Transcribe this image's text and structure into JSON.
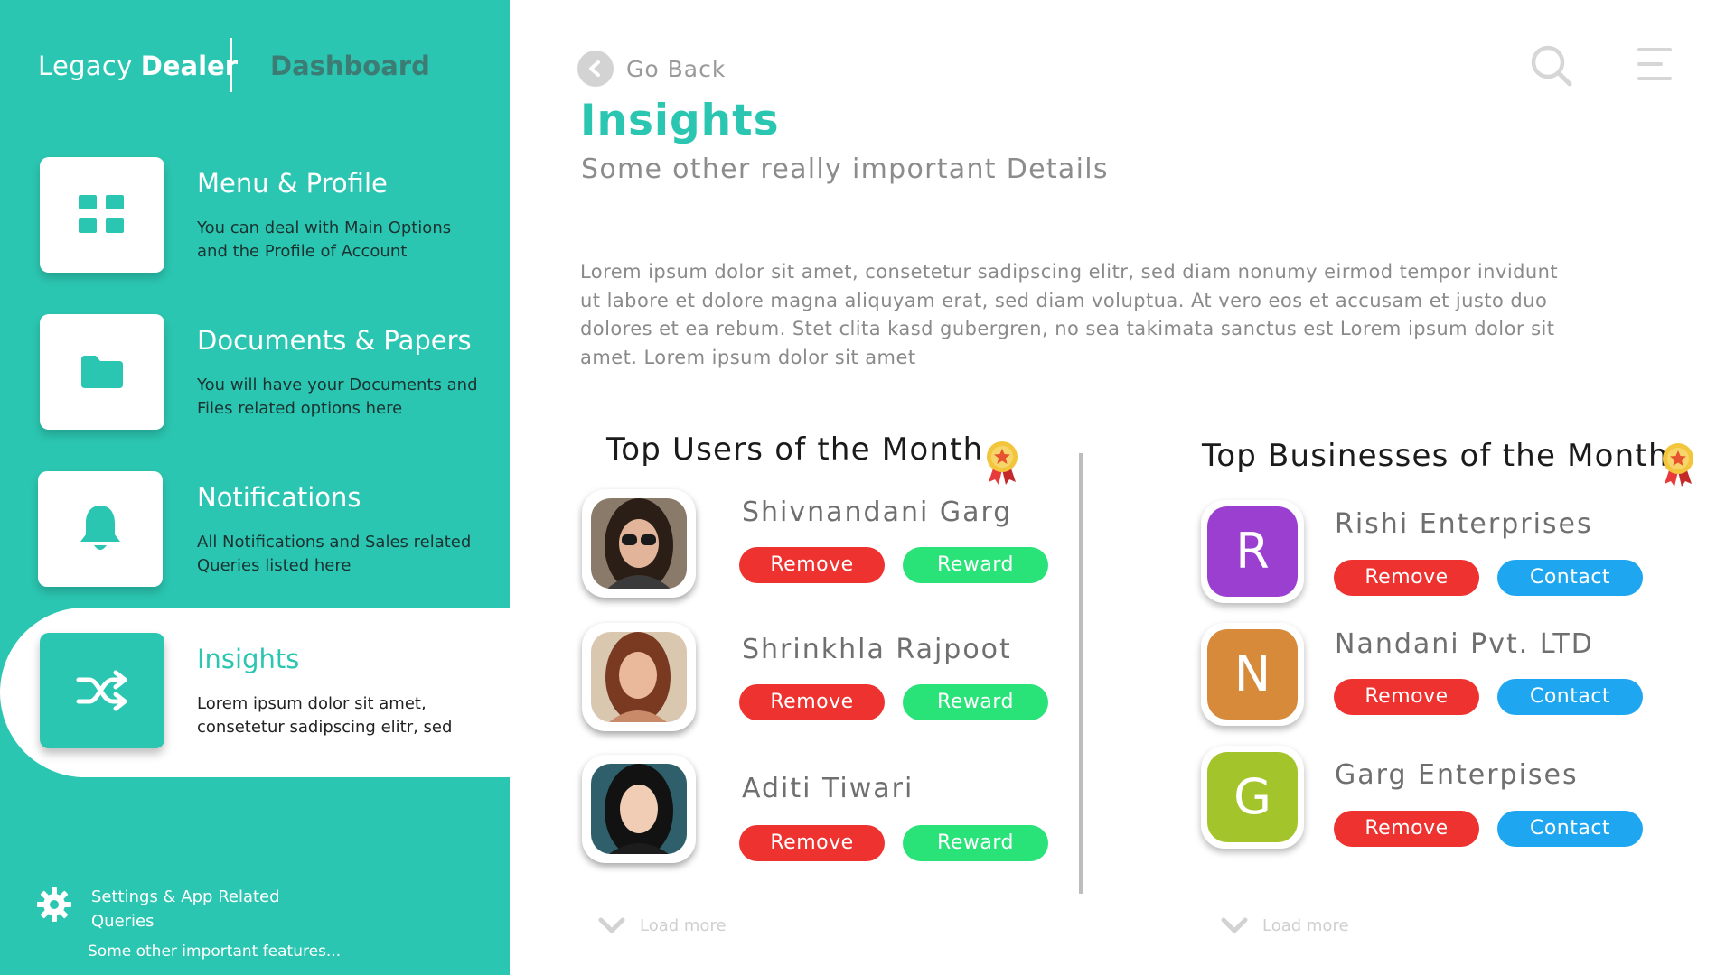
{
  "brand": {
    "light": "Legacy",
    "bold": "Dealer"
  },
  "header": {
    "section": "Dashboard",
    "go_back": "Go Back"
  },
  "sidebar": {
    "items": [
      {
        "title": "Menu & Profile",
        "desc": "You can deal with Main Options and the Profile of Account",
        "icon": "grid-icon"
      },
      {
        "title": "Documents & Papers",
        "desc": "You  will have your Documents and Files related options here",
        "icon": "folder-icon"
      },
      {
        "title": "Notifications",
        "desc": "All Notifications and Sales related Queries listed here",
        "icon": "bell-icon"
      },
      {
        "title": "Insights",
        "desc": "Lorem ipsum dolor sit amet, consetetur sadipscing elitr, sed",
        "icon": "shuffle-icon",
        "active": true
      }
    ],
    "settings": {
      "label": "Settings & App Related Queries",
      "sub": "Some other important features..."
    }
  },
  "main": {
    "title": "Insights",
    "subtitle": "Some other really important Details",
    "paragraph": "Lorem ipsum dolor sit amet, consetetur sadipscing elitr, sed diam nonumy eirmod tempor invidunt ut labore et dolore magna aliquyam erat, sed diam voluptua. At vero eos et accusam et justo duo dolores et ea rebum. Stet clita kasd gubergren, no sea takimata sanctus est Lorem ipsum dolor sit amet. Lorem ipsum dolor sit amet"
  },
  "top_users": {
    "title": "Top Users of the Month",
    "load_more": "Load more",
    "remove_label": "Remove",
    "reward_label": "Reward",
    "users": [
      {
        "name": "Shivnandani Garg"
      },
      {
        "name": "Shrinkhla Rajpoot"
      },
      {
        "name": "Aditi Tiwari"
      }
    ]
  },
  "top_businesses": {
    "title": "Top Businesses of the Month",
    "load_more": "Load more",
    "remove_label": "Remove",
    "contact_label": "Contact",
    "businesses": [
      {
        "letter": "R",
        "name": "Rishi Enterprises",
        "color": "#9b3fd1"
      },
      {
        "letter": "N",
        "name": "Nandani Pvt. LTD",
        "color": "#d68a3a"
      },
      {
        "letter": "G",
        "name": "Garg Enterpises",
        "color": "#a4c42b"
      }
    ]
  },
  "colors": {
    "accent": "#2bc6b1",
    "remove": "#ee3230",
    "reward": "#29e378",
    "contact": "#1ea7f0"
  }
}
